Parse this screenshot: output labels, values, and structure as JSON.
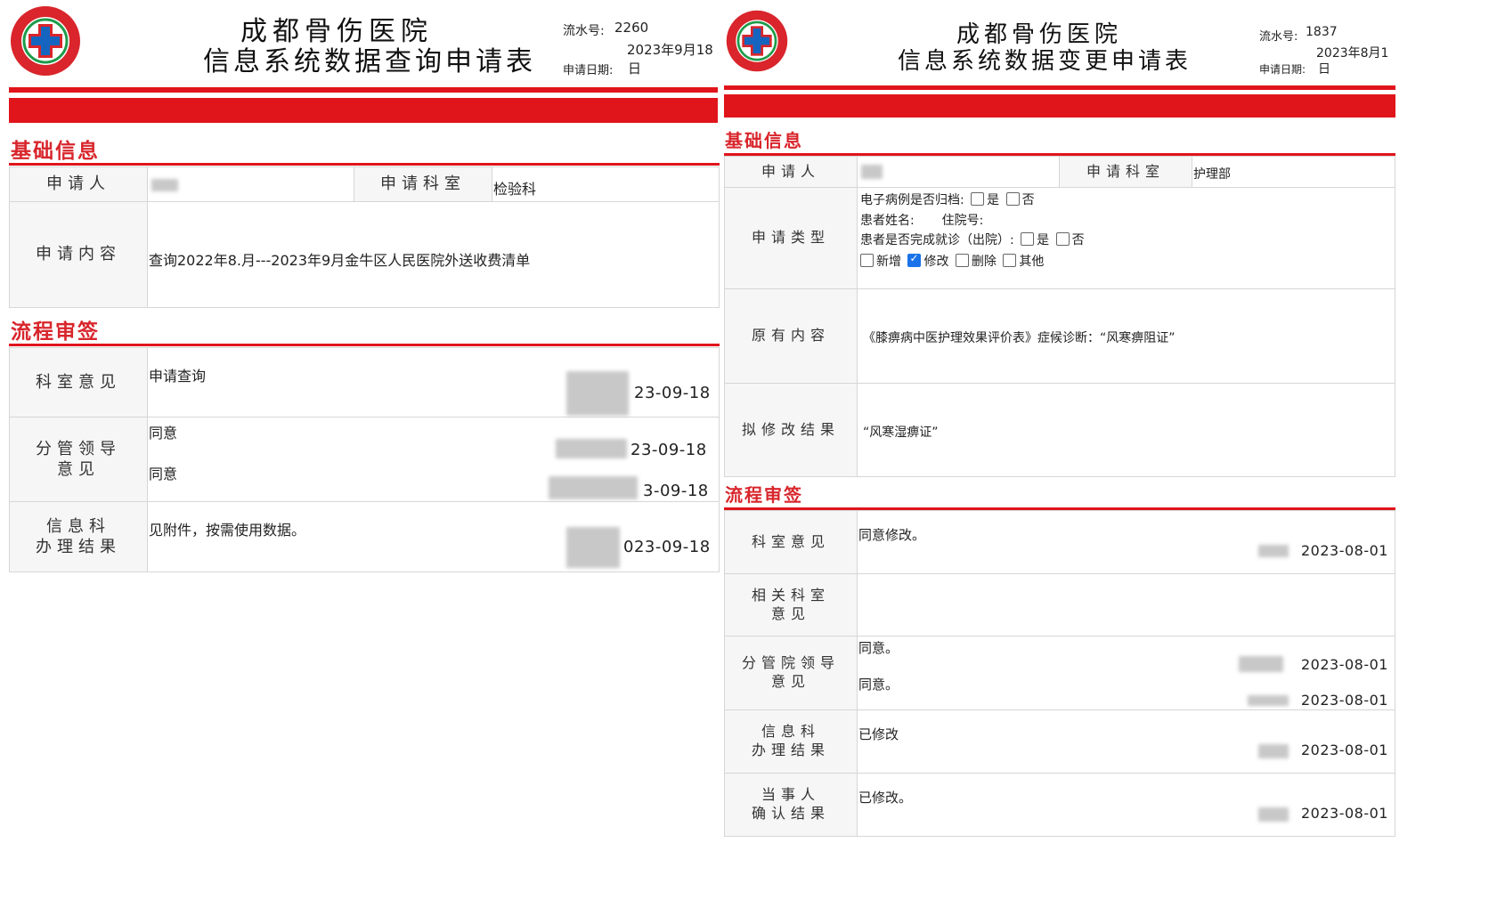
{
  "left": {
    "hospital": "成都骨伤医院",
    "form_title": "信息系统数据查询申请表",
    "serial_label": "流水号:",
    "serial_value": "2260",
    "date_value": "2023年9月18",
    "apply_date_label": "申请日期:",
    "apply_date_suffix": "日",
    "section_basic": "基础信息",
    "applicant_label": "申请人",
    "dept_label": "申请科室",
    "dept_value": "检验科",
    "content_label": "申请内容",
    "content_value": "查询2022年8.月---2023年9月金牛区人民医院外送收费清单",
    "section_flow": "流程审签",
    "opinion_dept_label": "科室意见",
    "opinion_dept_value": "申请查询",
    "opinion_dept_date": "23-09-18",
    "leader_label_1": "分管领导",
    "leader_label_2": "意见",
    "leader_value_1": "同意",
    "leader_date_1": "23-09-18",
    "leader_value_2": "同意",
    "leader_date_2": "3-09-18",
    "info_label_1": "信息科",
    "info_label_2": "办理结果",
    "info_value": "见附件，按需使用数据。",
    "info_date": "023-09-18"
  },
  "right": {
    "hospital": "成都骨伤医院",
    "form_title": "信息系统数据变更申请表",
    "serial_label": "流水号:",
    "serial_value": "1837",
    "date_value": "2023年8月1",
    "apply_date_label": "申请日期:",
    "apply_date_suffix": "日",
    "section_basic": "基础信息",
    "applicant_label": "申请人",
    "dept_label": "申请科室",
    "dept_value": "护理部",
    "type_label": "申请类型",
    "emr_archived": "电子病例是否归档:",
    "yes": "是",
    "no": "否",
    "patient_name": "患者姓名:",
    "inpatient_no": "住院号:",
    "visit_done": "患者是否完成就诊（出院）:",
    "opt_add": "新增",
    "opt_modify": "修改",
    "opt_delete": "删除",
    "opt_other": "其他",
    "original_label": "原有内容",
    "original_value": "《膝痹病中医护理效果评价表》症候诊断：“风寒痹阻证”",
    "proposed_label": "拟修改结果",
    "proposed_value": "“风寒湿痹证”",
    "section_flow": "流程审签",
    "opinion_dept_label": "科室意见",
    "opinion_dept_value": "同意修改。",
    "opinion_dept_date": "2023-08-01",
    "related_label_1": "相关科室",
    "related_label_2": "意见",
    "leader_label_1": "分管院领导",
    "leader_label_2": "意见",
    "leader_value_1": "同意。",
    "leader_date_1": "2023-08-01",
    "leader_value_2": "同意。",
    "leader_date_2": "2023-08-01",
    "info_label_1": "信息科",
    "info_label_2": "办理结果",
    "info_value": "已修改",
    "info_date": "2023-08-01",
    "party_label_1": "当事人",
    "party_label_2": "确认结果",
    "party_value": "已修改。",
    "party_date": "2023-08-01"
  }
}
